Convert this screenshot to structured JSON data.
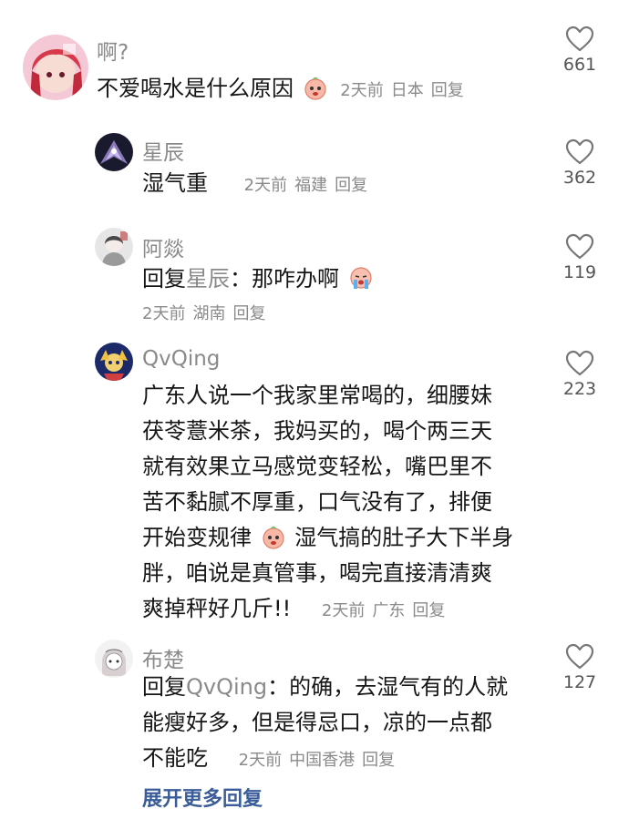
{
  "comments": [
    {
      "username": "啊?",
      "text_lines": [
        "不爱喝水是什么原因"
      ],
      "time": "2天前",
      "location": "日本",
      "reply_label": "回复",
      "likes": "661",
      "avatar_icon": "avatar-red-hair-girl"
    },
    {
      "username": "星辰",
      "text_lines": [
        "湿气重"
      ],
      "time": "2天前",
      "location": "福建",
      "reply_label": "回复",
      "likes": "362",
      "avatar_icon": "avatar-dark-purple-wings"
    },
    {
      "username": "阿燚",
      "reply_prefix": "回复",
      "mention": "星辰",
      "text_lines": [
        "：那咋办啊"
      ],
      "time": "2天前",
      "location": "湖南",
      "reply_label": "回复",
      "likes": "119",
      "avatar_icon": "avatar-grey-anime"
    },
    {
      "username": "QvQing",
      "text_lines": [
        "广东人说一个我家里常喝的，细腰妹",
        "茯苓薏米茶，我妈买的，喝个两三天",
        "就有效果立马感觉变轻松，嘴巴里不",
        "苦不黏腻不厚重，口气没有了，排便",
        "开始变规律",
        "湿气搞的肚子大下半身",
        "胖，咱说是真管事，喝完直接清清爽",
        "爽掉秤好几斤!!"
      ],
      "time": "2天前",
      "location": "广东",
      "reply_label": "回复",
      "likes": "223",
      "avatar_icon": "avatar-navy-gold-character"
    },
    {
      "username": "布楚",
      "reply_prefix": "回复",
      "mention": "QvQing",
      "text_lines": [
        "：的确，去湿气有的人就",
        "能瘦好多，但是得忌口，凉的一点都",
        "不能吃"
      ],
      "time": "2天前",
      "location": "中国香港",
      "reply_label": "回复",
      "likes": "127",
      "avatar_icon": "avatar-sketch-girl"
    }
  ],
  "expand_more": "展开更多回复",
  "icons": {
    "like": "heart-outline-icon",
    "emoji_peach": "peach-emoji-icon",
    "emoji_crying": "crying-emoji-icon"
  },
  "colors": {
    "username": "#8a8a8a",
    "text": "#161616",
    "link": "#3a5c99"
  }
}
